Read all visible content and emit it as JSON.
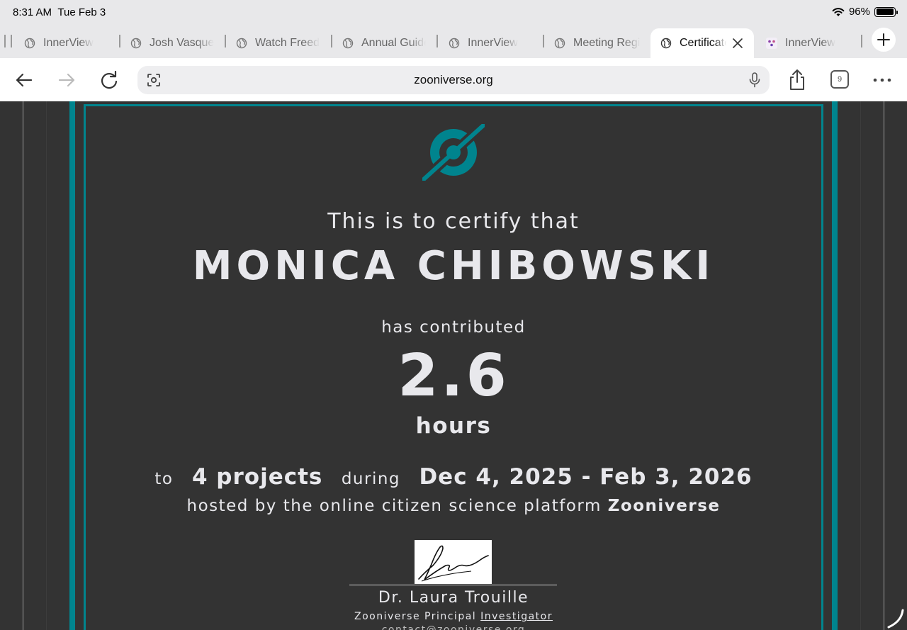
{
  "status_bar": {
    "time": "8:31 AM",
    "date": "Tue Feb 3",
    "battery": "96%",
    "battery_level": 0.96
  },
  "tabs": [
    {
      "title": "InnerView",
      "icon": "globe-icon"
    },
    {
      "title": "Josh Vasquez",
      "icon": "globe-icon"
    },
    {
      "title": "Watch Freedom",
      "icon": "globe-icon"
    },
    {
      "title": "Annual Guide",
      "icon": "globe-icon"
    },
    {
      "title": "InnerView",
      "icon": "globe-icon"
    },
    {
      "title": "Meeting Registration",
      "icon": "globe-icon"
    },
    {
      "title": "Certificate",
      "icon": "globe-icon",
      "active": true
    },
    {
      "title": "InnerView",
      "icon": "innerview-logo-icon"
    }
  ],
  "toolbar": {
    "url": "zooniverse.org",
    "tab_count": "9"
  },
  "certificate": {
    "heading": "This is to certify that",
    "name": "MONICA CHIBOWSKI",
    "contributed_label": "has contributed",
    "value": "2.6",
    "unit": "hours",
    "to_label": "to",
    "projects": "4 projects",
    "during_label": "during",
    "date_range": "Dec 4, 2025 - Feb 3, 2026",
    "hosted_label": "hosted by the online citizen science platform",
    "platform": "Zooniverse",
    "signer_name": "Dr. Laura Trouille",
    "signer_role_prefix": "Zooniverse Principal",
    "signer_role_suffix": "Investigator",
    "signer_contact": "contact@zooniverse.org",
    "accent_color": "#00848e"
  }
}
